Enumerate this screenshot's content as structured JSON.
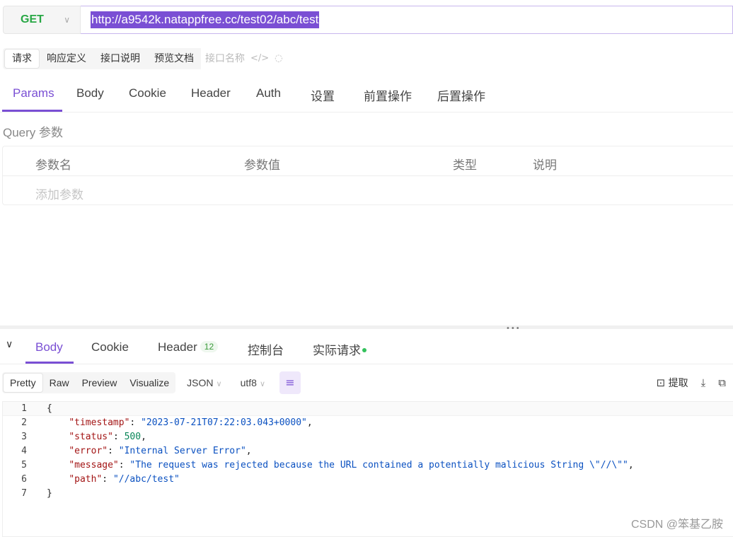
{
  "request": {
    "method": "GET",
    "url": "http://a9542k.natappfree.cc/test02/abc/test"
  },
  "subtabs": [
    "请求",
    "响应定义",
    "接口说明",
    "预览文档"
  ],
  "api_name_placeholder": "接口名称",
  "main_tabs": [
    "Params",
    "Body",
    "Cookie",
    "Header",
    "Auth",
    "设置",
    "前置操作",
    "后置操作"
  ],
  "query": {
    "title": "Query 参数",
    "columns": [
      "参数名",
      "参数值",
      "类型",
      "说明"
    ],
    "add_placeholder": "添加参数"
  },
  "response": {
    "tabs": [
      "Body",
      "Cookie",
      "Header",
      "控制台",
      "实际请求"
    ],
    "header_count": "12",
    "formats": [
      "Pretty",
      "Raw",
      "Preview",
      "Visualize"
    ],
    "type": "JSON",
    "encoding": "utf8",
    "extract_label": "提取",
    "code_lines": [
      "{",
      "    \"timestamp\": \"2023-07-21T07:22:03.043+0000\",",
      "    \"status\": 500,",
      "    \"error\": \"Internal Server Error\",",
      "    \"message\": \"The request was rejected because the URL contained a potentially malicious String \\\"//\\\"\",",
      "    \"path\": \"//abc/test\"",
      "}"
    ],
    "line_numbers": [
      "1",
      "2",
      "3",
      "4",
      "5",
      "6",
      "7"
    ]
  },
  "watermark": "CSDN @笨基乙胺",
  "colors": {
    "accent": "#7a4fd4",
    "method": "#28a745"
  }
}
